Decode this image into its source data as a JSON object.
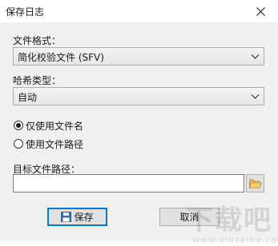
{
  "window": {
    "title": "保存日志"
  },
  "format": {
    "label": "文件格式：",
    "selected": "简化校验文件 (SFV)"
  },
  "hash_type": {
    "label": "哈希类型：",
    "selected": "自动"
  },
  "name_mode": {
    "option_name_only": "仅使用文件名",
    "option_full_path": "使用文件路径",
    "selected": "仅使用文件名"
  },
  "target": {
    "label": "目标文件路径：",
    "value": ""
  },
  "buttons": {
    "save_label": "保存",
    "cancel_label": "取消"
  },
  "watermark": {
    "main": "下载吧",
    "sub": "www.xiazaiba.com"
  },
  "colors": {
    "accent": "#0078d7",
    "client_bg": "#f0f0f0",
    "folder_icon": "#e8b84a"
  },
  "icons": {
    "close": "close-icon",
    "dropdown": "chevron-down-icon",
    "browse": "folder-open-icon",
    "save": "floppy-disk-icon"
  }
}
